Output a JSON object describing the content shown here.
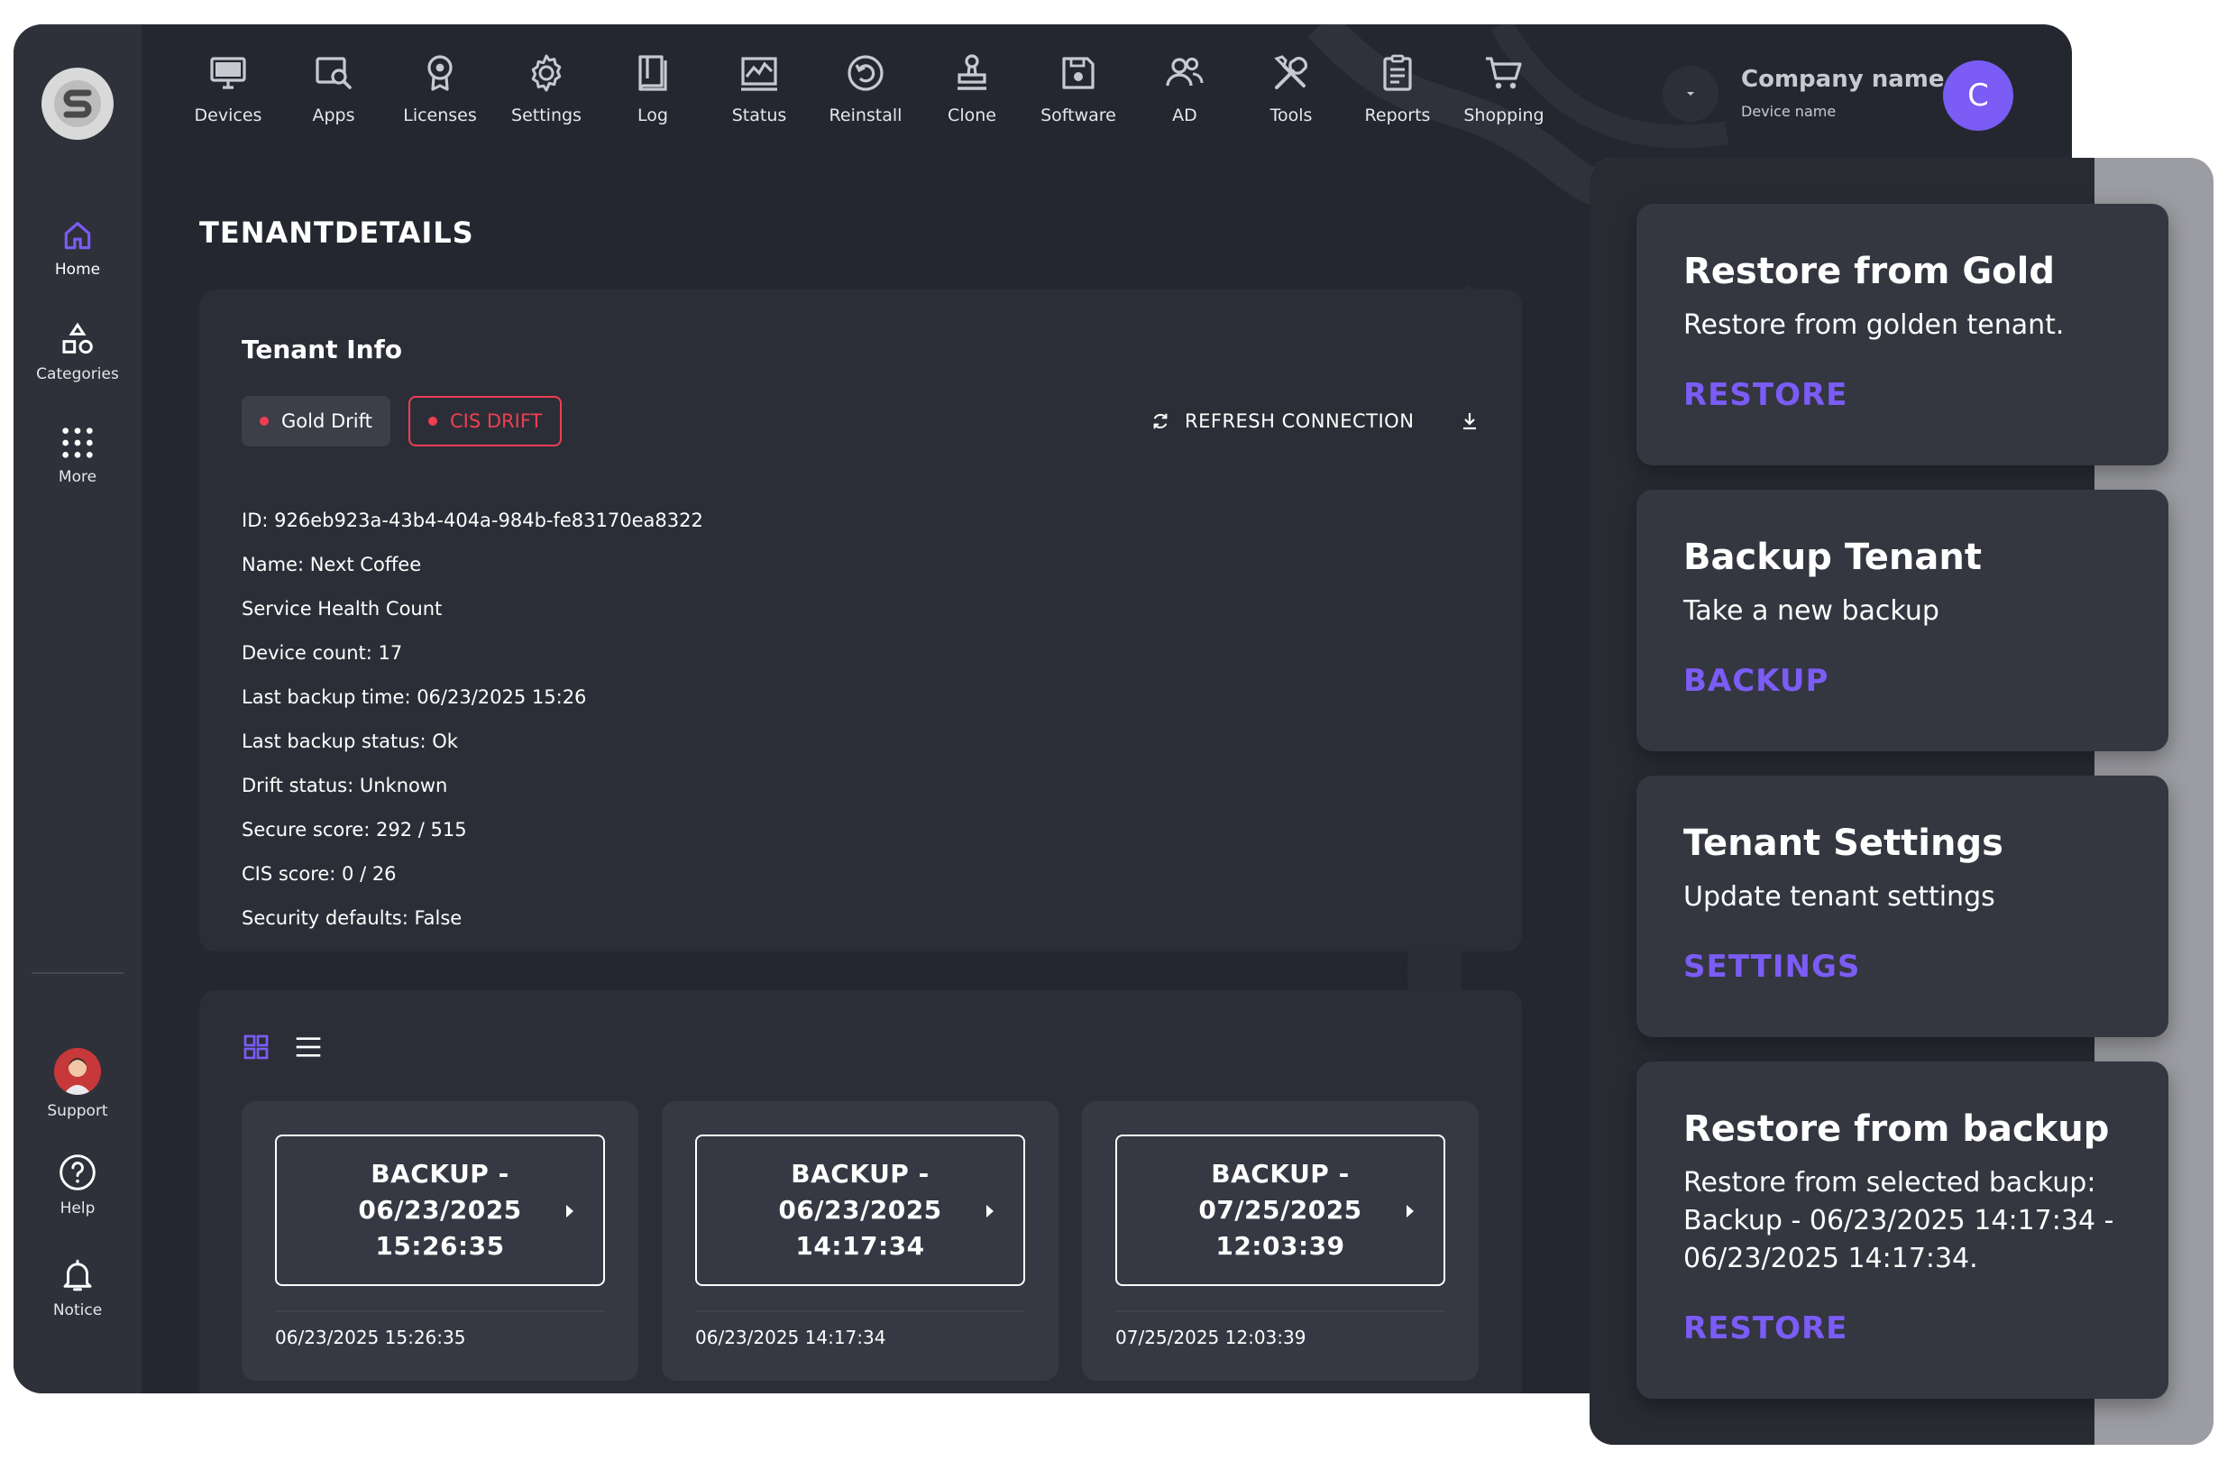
{
  "nav": {
    "items": [
      {
        "label": "Home",
        "icon": "home-icon",
        "active": true
      },
      {
        "label": "Categories",
        "icon": "categories-icon"
      },
      {
        "label": "More",
        "icon": "grid-dots-icon"
      }
    ],
    "bottom": [
      {
        "label": "Support",
        "icon": "support-avatar"
      },
      {
        "label": "Help",
        "icon": "help-icon"
      },
      {
        "label": "Notice",
        "icon": "bell-icon"
      }
    ]
  },
  "toolbar": {
    "items": [
      {
        "label": "Devices",
        "icon": "monitor-icon"
      },
      {
        "label": "Apps",
        "icon": "apps-search-icon"
      },
      {
        "label": "Licenses",
        "icon": "license-badge-icon"
      },
      {
        "label": "Settings",
        "icon": "gear-icon"
      },
      {
        "label": "Log",
        "icon": "book-icon"
      },
      {
        "label": "Status",
        "icon": "status-chart-icon"
      },
      {
        "label": "Reinstall",
        "icon": "reinstall-icon"
      },
      {
        "label": "Clone",
        "icon": "stamp-icon"
      },
      {
        "label": "Software",
        "icon": "floppy-icon"
      },
      {
        "label": "AD",
        "icon": "users-icon"
      },
      {
        "label": "Tools",
        "icon": "tools-icon"
      },
      {
        "label": "Reports",
        "icon": "clipboard-icon"
      },
      {
        "label": "Shopping",
        "icon": "cart-icon"
      }
    ]
  },
  "header": {
    "company_name": "Company name",
    "device_name": "Device name",
    "avatar_letter": "C"
  },
  "page": {
    "title": "TENANTDETAILS"
  },
  "tenant_info": {
    "title": "Tenant Info",
    "chips": {
      "gold": "Gold Drift",
      "cis": "CIS DRIFT"
    },
    "refresh_label": "REFRESH CONNECTION",
    "lines": [
      "ID: 926eb923a-43b4-404a-984b-fe83170ea8322",
      "Name: Next Coffee",
      "Service Health Count",
      "Device count: 17",
      "Last backup time: 06/23/2025 15:26",
      "Last backup status: Ok",
      "Drift status: Unknown",
      "Secure score: 292 / 515",
      "CIS score: 0 / 26",
      "Security defaults: False"
    ]
  },
  "backups": {
    "items": [
      {
        "line1": "BACKUP -",
        "line2": "06/23/2025",
        "line3": "15:26:35",
        "date": "06/23/2025 15:26:35"
      },
      {
        "line1": "BACKUP -",
        "line2": "06/23/2025",
        "line3": "14:17:34",
        "date": "06/23/2025 14:17:34"
      },
      {
        "line1": "BACKUP -",
        "line2": "07/25/2025",
        "line3": "12:03:39",
        "date": "07/25/2025 12:03:39"
      }
    ]
  },
  "actions": [
    {
      "title": "Restore from Gold",
      "desc": "Restore from golden tenant.",
      "link": "RESTORE"
    },
    {
      "title": "Backup Tenant",
      "desc": "Take a new backup",
      "link": "BACKUP"
    },
    {
      "title": "Tenant Settings",
      "desc": "Update tenant settings",
      "link": "SETTINGS"
    },
    {
      "title": "Restore from backup",
      "desc": "Restore from selected backup: Backup - 06/23/2025 14:17:34 - 06/23/2025 14:17:34.",
      "link": "RESTORE"
    }
  ],
  "colors": {
    "accent": "#7b5cf5",
    "drift_red": "#ef3e52",
    "app_bg": "#252730",
    "card_bg": "#2c2e37"
  }
}
